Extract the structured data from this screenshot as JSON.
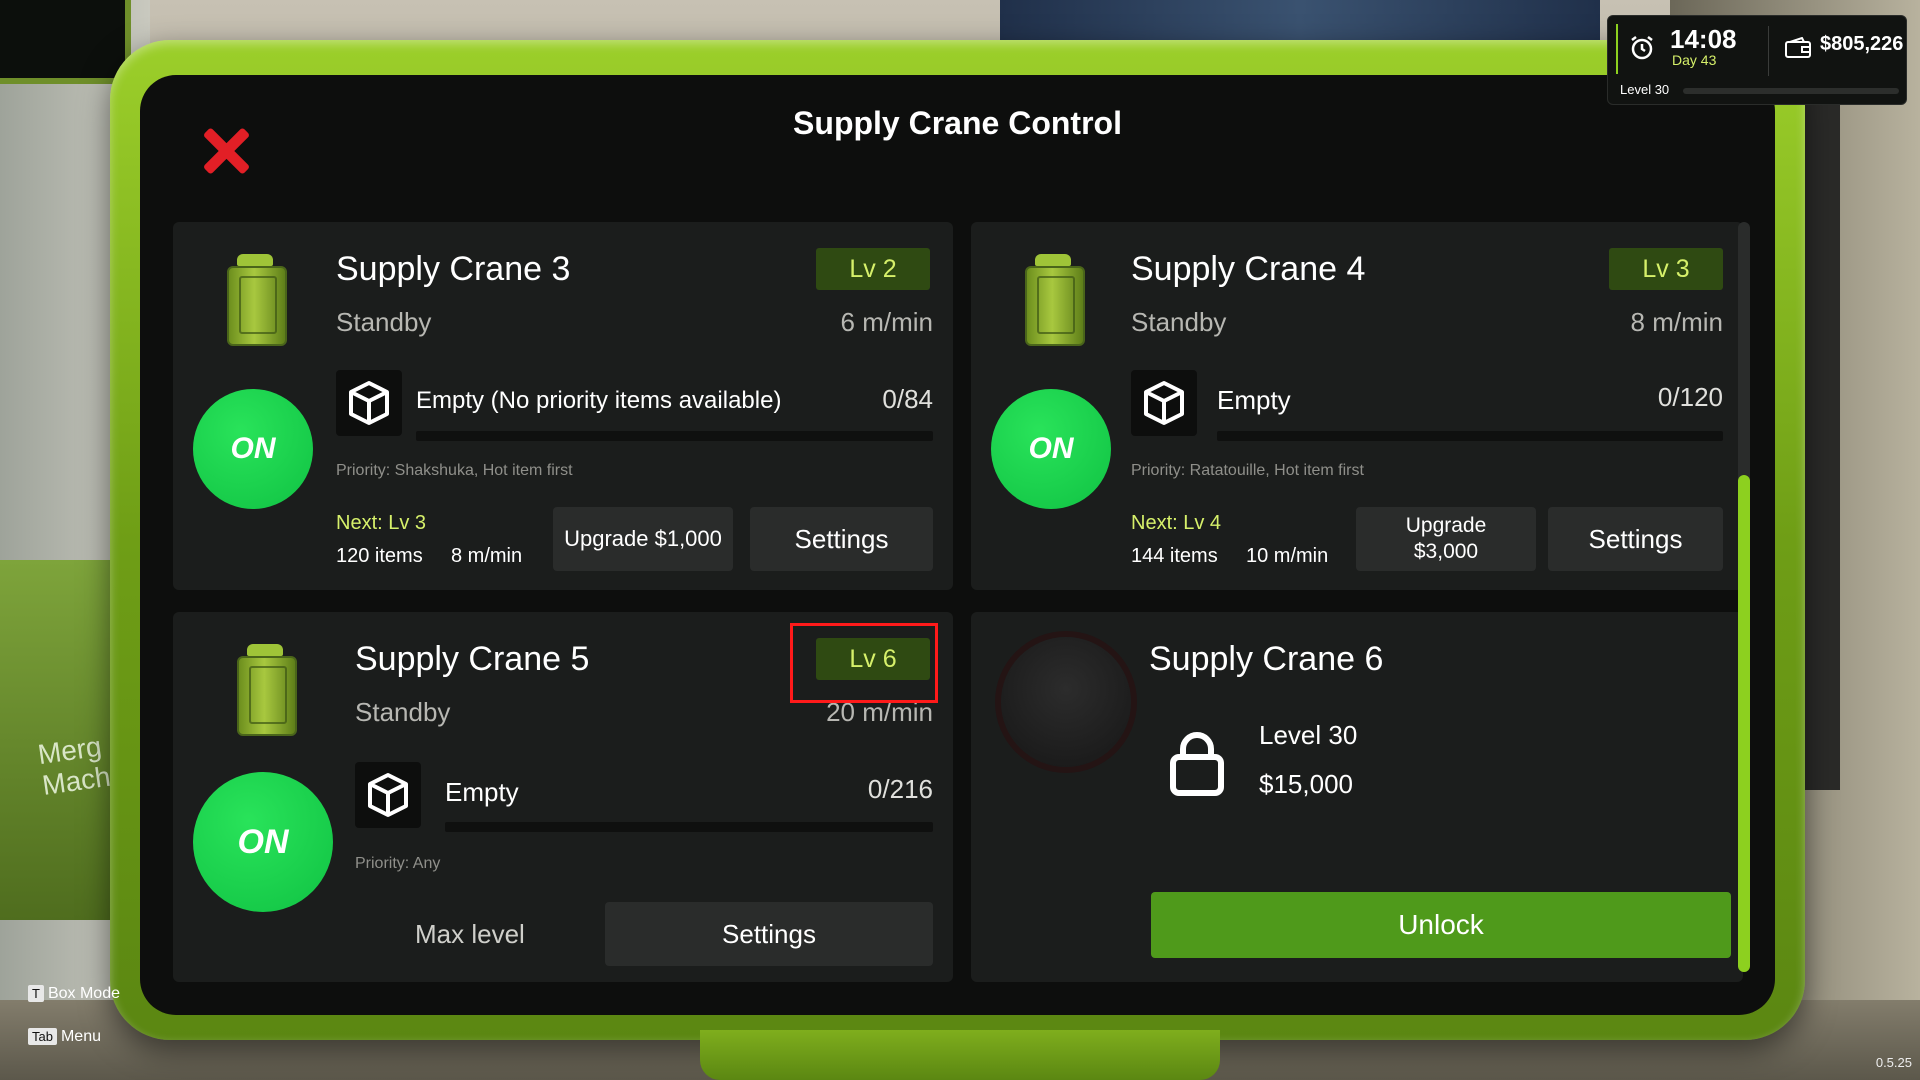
{
  "window": {
    "title": "Supply Crane Control"
  },
  "hud": {
    "time": "14:08",
    "day": "Day 43",
    "money": "$805,226",
    "level": "Level 30"
  },
  "cards": [
    {
      "name": "Supply Crane 3",
      "status": "Standby",
      "level": "Lv 2",
      "speed": "6 m/min",
      "power": "ON",
      "item": "Empty (No priority items available)",
      "count": "0/84",
      "priority": "Priority: Shakshuka, Hot item first",
      "next_level": "Next: Lv 3",
      "next_items": "120 items",
      "next_speed": "8 m/min",
      "upgrade_label": "Upgrade $1,000",
      "settings_label": "Settings"
    },
    {
      "name": "Supply Crane 4",
      "status": "Standby",
      "level": "Lv 3",
      "speed": "8 m/min",
      "power": "ON",
      "item": "Empty",
      "count": "0/120",
      "priority": "Priority: Ratatouille, Hot item first",
      "next_level": "Next: Lv 4",
      "next_items": "144 items",
      "next_speed": "10 m/min",
      "upgrade_label": "Upgrade",
      "upgrade_price": "$3,000",
      "settings_label": "Settings"
    },
    {
      "name": "Supply Crane 5",
      "status": "Standby",
      "level": "Lv 6",
      "speed": "20 m/min",
      "power": "ON",
      "item": "Empty",
      "count": "0/216",
      "priority": "Priority: Any",
      "max_label": "Max level",
      "settings_label": "Settings"
    },
    {
      "name": "Supply Crane 6",
      "required_level": "Level 30",
      "price": "$15,000",
      "unlock_label": "Unlock"
    }
  ],
  "hints": {
    "box_mode_key": "T",
    "box_mode_label": "Box Mode",
    "menu_key": "Tab",
    "menu_label": "Menu"
  },
  "background_text": {
    "machine_label": "Merg\nMachi"
  },
  "version": "0.5.25",
  "colors": {
    "accent_green": "#10c243",
    "lv_text": "#d6f06a",
    "unlock_green": "#4f9a1b",
    "close_red": "#e21f26",
    "highlight_red": "#ff1a1a"
  }
}
